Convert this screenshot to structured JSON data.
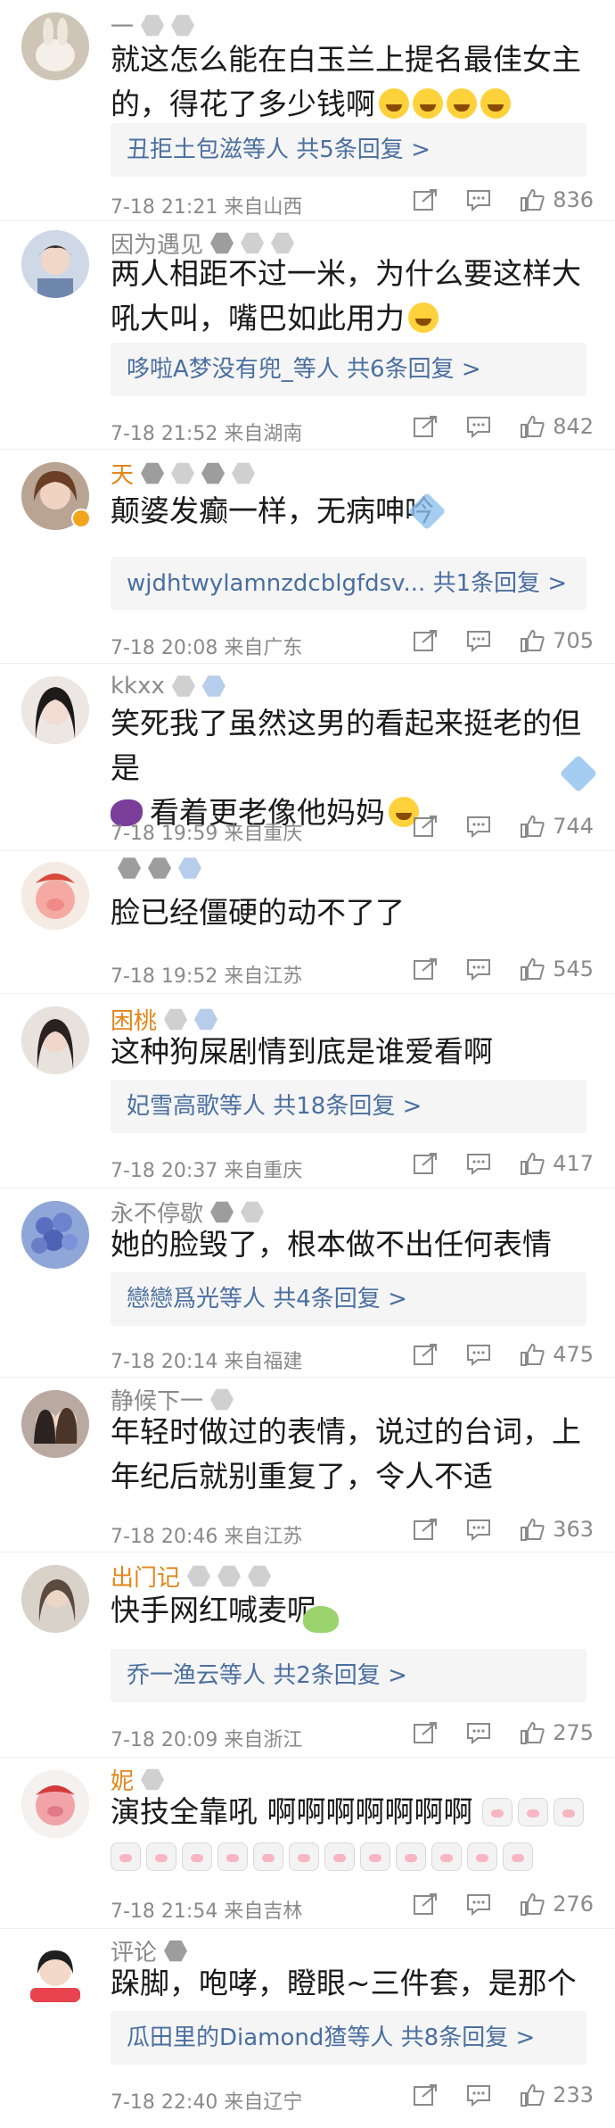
{
  "colors": {
    "link": "#4a6fa0",
    "username_orange": "#e0861a",
    "meta_gray": "#8a8a8a",
    "reply_bg": "#f5f5f5"
  },
  "icons": {
    "share": "share-icon",
    "comment": "comment-icon",
    "like": "like-icon"
  },
  "comments": [
    {
      "username": "一",
      "text": "就这怎么能在白玉兰上提名最佳女主的，得花了多少钱啊",
      "reply": "丑拒土包滋等人 共5条回复 >",
      "date": "7-18 21:21",
      "location": "来自山西",
      "likes": "836"
    },
    {
      "username": "因为遇见",
      "text": "两人相距不过一米，为什么要这样大吼大叫，嘴巴如此用力",
      "reply": "哆啦A梦没有兜_等人 共6条回复 >",
      "date": "7-18 21:52",
      "location": "来自湖南",
      "likes": "842"
    },
    {
      "username": "天",
      "text": "颠婆发癫一样，无病呻吟",
      "reply": "wjdhtwylamnzdcblgfdsv... 共1条回复 >",
      "date": "7-18 20:08",
      "location": "来自广东",
      "likes": "705"
    },
    {
      "username": "kkxx",
      "text_a": "笑死我了虽然这男的看起来挺老的但是",
      "text_b": "看着更老像他妈妈",
      "reply": "",
      "date": "7-18 19:59",
      "location": "来自重庆",
      "likes": "744"
    },
    {
      "username": "",
      "text": "脸已经僵硬的动不了了",
      "reply": "",
      "date": "7-18 19:52",
      "location": "来自江苏",
      "likes": "545"
    },
    {
      "username": "困桃",
      "text": "这种狗屎剧情到底是谁爱看啊",
      "reply": "妃雪高歌等人 共18条回复 >",
      "date": "7-18 20:37",
      "location": "来自重庆",
      "likes": "417"
    },
    {
      "username": "永不停歇",
      "text": "她的脸毁了，根本做不出任何表情",
      "reply": "戀戀爲光等人 共4条回复 >",
      "date": "7-18 20:14",
      "location": "来自福建",
      "likes": "475"
    },
    {
      "username": "静候下一",
      "text": "年轻时做过的表情，说过的台词，上年纪后就别重复了，令人不适",
      "reply": "",
      "date": "7-18 20:46",
      "location": "来自江苏",
      "likes": "363"
    },
    {
      "username": "出门记",
      "text": "快手网红喊麦呢",
      "reply": "乔一渔云等人 共2条回复 >",
      "date": "7-18 20:09",
      "location": "来自浙江",
      "likes": "275"
    },
    {
      "username": "妮",
      "text": "演技全靠吼  啊啊啊啊啊啊啊",
      "reply": "",
      "date": "7-18 21:54",
      "location": "来自吉林",
      "likes": "276"
    },
    {
      "username": "评论",
      "text": "跺脚，咆哮，瞪眼~三件套，是那个味儿",
      "reply": "瓜田里的Diamond猹等人 共8条回复 >",
      "date": "7-18 22:40",
      "location": "来自辽宁",
      "likes": "233"
    }
  ]
}
